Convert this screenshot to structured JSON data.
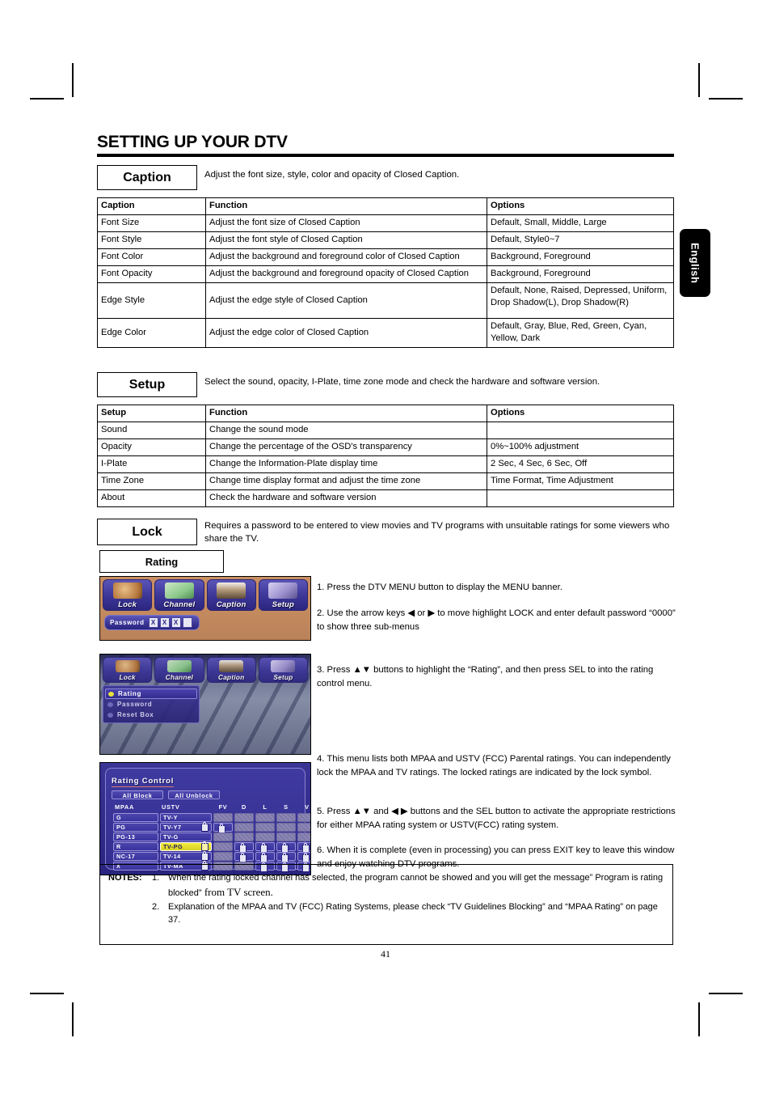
{
  "document": {
    "title": "SETTING UP YOUR DTV",
    "page_number": "41",
    "side_tab": "English"
  },
  "caption_section": {
    "label": "Caption",
    "description": "Adjust the font size, style, color and opacity of Closed Caption.",
    "headers": [
      "Caption",
      "Function",
      "Options"
    ],
    "rows": [
      {
        "name": "Font Size",
        "function": "Adjust the font size of Closed Caption",
        "options": "Default, Small, Middle, Large"
      },
      {
        "name": "Font Style",
        "function": "Adjust the font style of Closed Caption",
        "options": "Default, Style0~7"
      },
      {
        "name": "Font Color",
        "function": "Adjust the background and foreground color of Closed Caption",
        "options": "Background, Foreground"
      },
      {
        "name": "Font Opacity",
        "function": "Adjust the background and foreground opacity of Closed Caption",
        "options": "Background, Foreground"
      },
      {
        "name": "Edge Style",
        "function": "Adjust the edge style of Closed Caption",
        "options": "Default, None, Raised, Depressed, Uniform, Drop Shadow(L), Drop Shadow(R)"
      },
      {
        "name": "Edge Color",
        "function": "Adjust the edge color of Closed Caption",
        "options": "Default, Gray, Blue, Red, Green, Cyan, Yellow, Dark"
      }
    ]
  },
  "setup_section": {
    "label": "Setup",
    "description": "Select the sound, opacity, I-Plate, time zone mode and check the hardware and software version.",
    "headers": [
      "Setup",
      "Function",
      "Options"
    ],
    "rows": [
      {
        "name": "Sound",
        "function": "Change the sound mode",
        "options": ""
      },
      {
        "name": "Opacity",
        "function": "Change the percentage of the OSD's transparency",
        "options": "0%~100% adjustment"
      },
      {
        "name": "I-Plate",
        "function": "Change the Information-Plate display time",
        "options": "2 Sec, 4 Sec, 6 Sec, Off"
      },
      {
        "name": "Time Zone",
        "function": "Change time display format and adjust the time zone",
        "options": "Time Format, Time Adjustment"
      },
      {
        "name": "About",
        "function": "Check the hardware and software version",
        "options": ""
      }
    ]
  },
  "lock_section": {
    "label": "Lock",
    "description": "Requires a password to be entered to view movies and TV programs with unsuitable ratings for some viewers who share the TV.",
    "rating_label": "Rating"
  },
  "steps": [
    "1. Press the DTV MENU button to display the MENU banner.",
    "2. Use the arrow keys ◀ or ▶ to move highlight LOCK and enter default password “0000” to show three sub-menus",
    "3. Press ▲▼ buttons to highlight the “Rating”, and then press SEL to into the rating control menu.",
    "4. This menu lists both MPAA and USTV (FCC) Parental ratings. You can independently lock the MPAA and TV ratings. The locked ratings are indicated by the lock symbol.",
    "5. Press ▲▼ and ◀ ▶ buttons and the SEL button to activate the appropriate restrictions for either MPAA rating system or USTV(FCC) rating system.",
    "6. When it is complete (even in processing) you can press EXIT key to leave this window and enjoy watching DTV programs."
  ],
  "osd_banner": {
    "tabs": [
      "Lock",
      "Channel",
      "Caption",
      "Setup"
    ],
    "password_label": "Password",
    "password_cells": [
      "X",
      "X",
      "X",
      ""
    ]
  },
  "osd_submenu": {
    "tabs": [
      "Lock",
      "Channel",
      "Caption",
      "Setup"
    ],
    "items": [
      "Rating",
      "Password",
      "Reset Box"
    ],
    "active_item": "Rating"
  },
  "rating_control": {
    "title": "Rating Control",
    "all_block_label": "All Block",
    "all_unblock_label": "All Unblock",
    "mpaa_header": "MPAA",
    "ustv_header": "USTV",
    "content_headers": [
      "FV",
      "D",
      "L",
      "S",
      "V"
    ],
    "rows": [
      {
        "mpaa": "G",
        "ustv": "TV-Y",
        "ustv_locked": false,
        "selected": false,
        "content": [
          false,
          false,
          false,
          false,
          false
        ]
      },
      {
        "mpaa": "PG",
        "ustv": "TV-Y7",
        "ustv_locked": true,
        "selected": false,
        "content": [
          true,
          false,
          false,
          false,
          false
        ]
      },
      {
        "mpaa": "PG-13",
        "ustv": "TV-G",
        "ustv_locked": false,
        "selected": false,
        "content": [
          false,
          false,
          false,
          false,
          false
        ]
      },
      {
        "mpaa": "R",
        "ustv": "TV-PG",
        "ustv_locked": true,
        "selected": true,
        "content": [
          false,
          true,
          true,
          true,
          true
        ]
      },
      {
        "mpaa": "NC-17",
        "ustv": "TV-14",
        "ustv_locked": true,
        "selected": false,
        "content": [
          false,
          true,
          true,
          true,
          true
        ]
      },
      {
        "mpaa": "X",
        "ustv": "TV-MA",
        "ustv_locked": true,
        "selected": false,
        "content": [
          false,
          false,
          true,
          true,
          true
        ]
      }
    ]
  },
  "notes": {
    "label": "NOTES:",
    "items": [
      {
        "num": "1.",
        "part1": "When the rating locked channel has selected, the program cannot be showed and you will get the message” Program is rating blocked”",
        "part2": " from TV screen."
      },
      {
        "num": "2.",
        "part1": "Explanation of the MPAA and TV (FCC) Rating Systems, please check “TV Guidelines Blocking” and “MPAA Rating” on page 37.",
        "part2": ""
      }
    ]
  }
}
